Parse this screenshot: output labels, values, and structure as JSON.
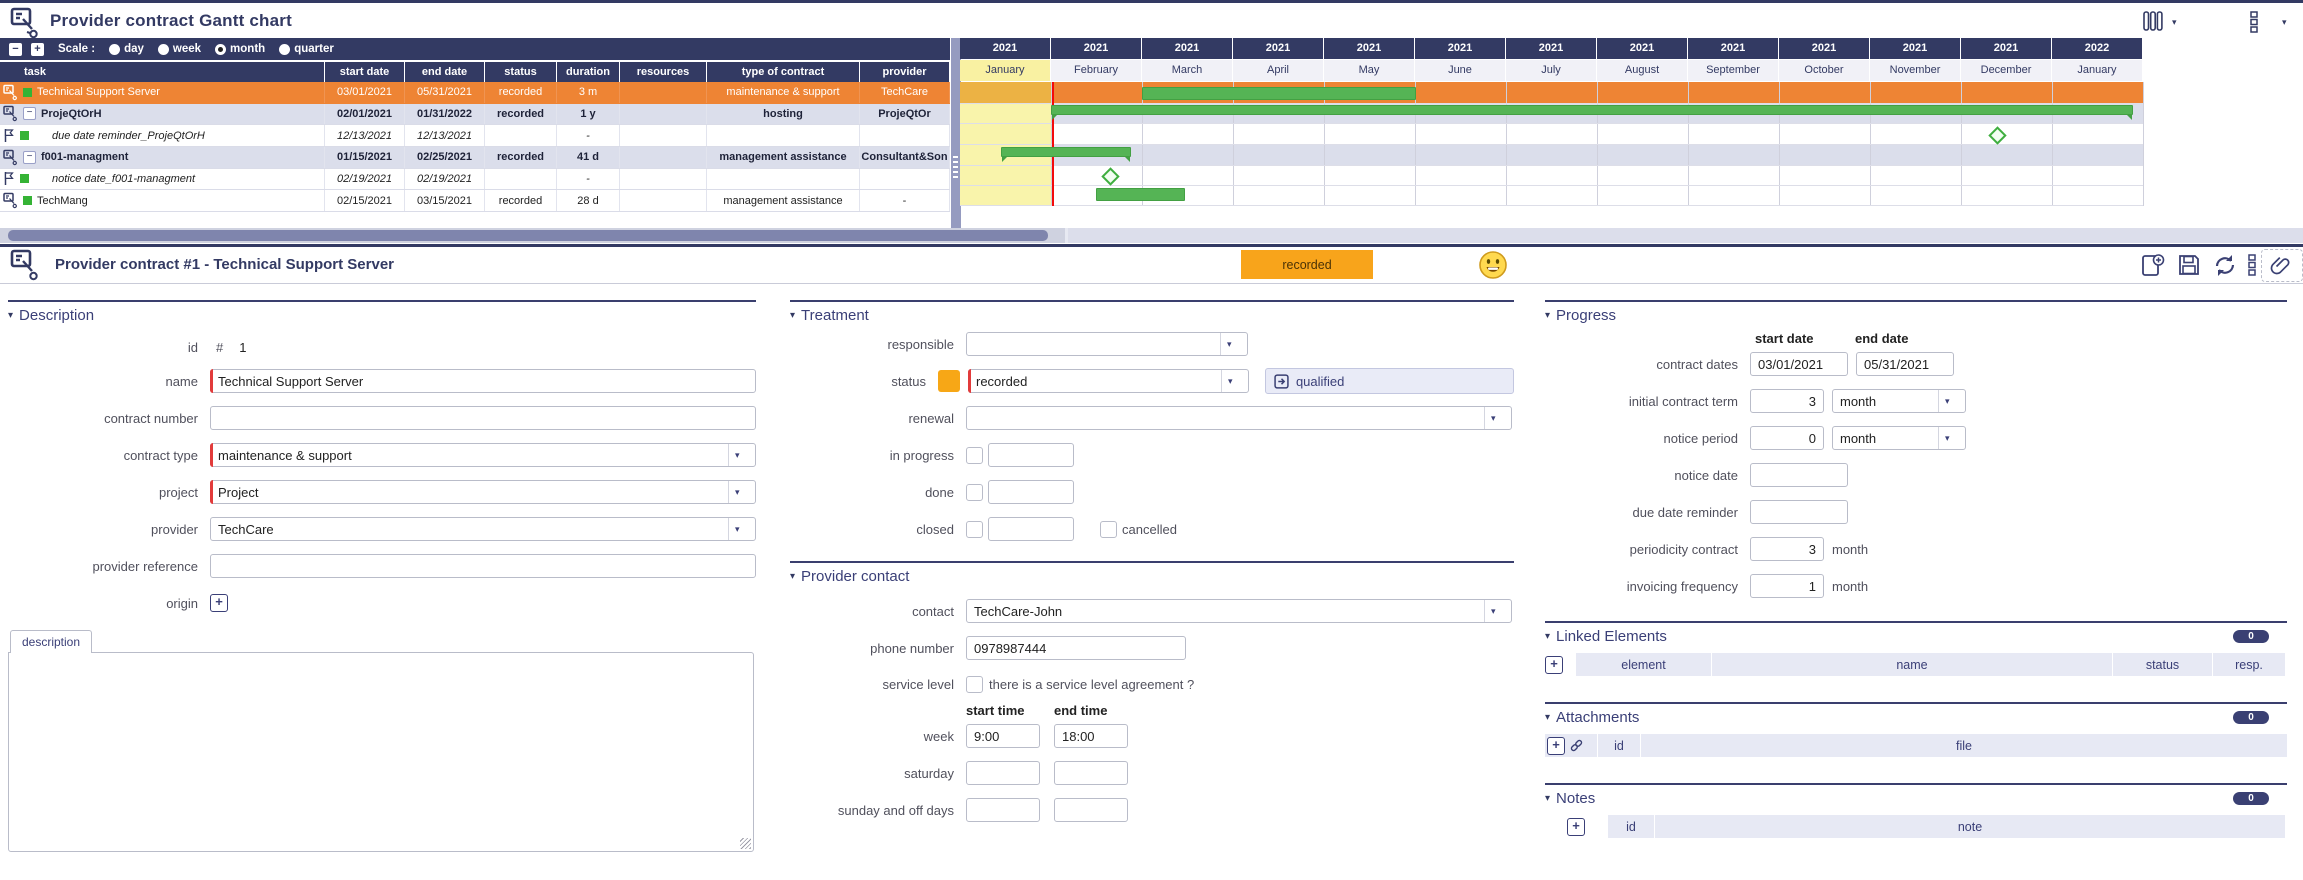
{
  "icons": {
    "caret_down": "▾",
    "plus": "+",
    "minus": "−",
    "hash": "#"
  },
  "theme": {
    "navy": "#333a63",
    "selected_orange": "#ee8434",
    "status_orange": "#f8a41b",
    "bar_green": "#55b455",
    "today_red": "#f30b0b",
    "current_month_yellow": "#f9f4ab",
    "required_red": "#e23b3b"
  },
  "gantt": {
    "title": "Provider contract Gantt chart",
    "scale_label": "Scale :",
    "scale_options": [
      {
        "label": "day",
        "selected": false
      },
      {
        "label": "week",
        "selected": false
      },
      {
        "label": "month",
        "selected": true
      },
      {
        "label": "quarter",
        "selected": false
      }
    ],
    "columns": [
      "task",
      "start date",
      "end date",
      "status",
      "duration",
      "resources",
      "type of contract",
      "provider"
    ],
    "rows": [
      {
        "task": "Technical Support Server",
        "start_date": "03/01/2021",
        "end_date": "05/31/2021",
        "status": "recorded",
        "duration": "3 m",
        "resources": "",
        "type_of_contract": "maintenance & support",
        "provider": "TechCare"
      },
      {
        "task": "ProjeQtOrH",
        "start_date": "02/01/2021",
        "end_date": "01/31/2022",
        "status": "recorded",
        "duration": "1 y",
        "resources": "",
        "type_of_contract": "hosting",
        "provider": "ProjeQtOr",
        "collapse": "−"
      },
      {
        "task": "due date reminder_ProjeQtOrH",
        "start_date": "12/13/2021",
        "end_date": "12/13/2021",
        "status": "",
        "duration": "-",
        "resources": "",
        "type_of_contract": "",
        "provider": ""
      },
      {
        "task": "f001-managment",
        "start_date": "01/15/2021",
        "end_date": "02/25/2021",
        "status": "recorded",
        "duration": "41 d",
        "resources": "",
        "type_of_contract": "management assistance",
        "provider": "Consultant&Son",
        "collapse": "−"
      },
      {
        "task": "notice date_f001-managment",
        "start_date": "02/19/2021",
        "end_date": "02/19/2021",
        "status": "",
        "duration": "-",
        "resources": "",
        "type_of_contract": "",
        "provider": ""
      },
      {
        "task": "TechMang",
        "start_date": "02/15/2021",
        "end_date": "03/15/2021",
        "status": "recorded",
        "duration": "28 d",
        "resources": "",
        "type_of_contract": "management assistance",
        "provider": "-"
      }
    ],
    "timeline": {
      "cols": [
        {
          "y": "2021",
          "m": "January"
        },
        {
          "y": "2021",
          "m": "February"
        },
        {
          "y": "2021",
          "m": "March"
        },
        {
          "y": "2021",
          "m": "April"
        },
        {
          "y": "2021",
          "m": "May"
        },
        {
          "y": "2021",
          "m": "June"
        },
        {
          "y": "2021",
          "m": "July"
        },
        {
          "y": "2021",
          "m": "August"
        },
        {
          "y": "2021",
          "m": "September"
        },
        {
          "y": "2021",
          "m": "October"
        },
        {
          "y": "2021",
          "m": "November"
        },
        {
          "y": "2021",
          "m": "December"
        },
        {
          "y": "2022",
          "m": "January"
        }
      ]
    }
  },
  "detail": {
    "header": {
      "title": "Provider contract  #1  - Technical Support Server",
      "status_badge": "recorded"
    },
    "description": {
      "title": "Description",
      "id_label": "id",
      "id_value": "1",
      "name_label": "name",
      "name_value": "Technical Support Server",
      "contract_number_label": "contract number",
      "contract_number_value": "",
      "contract_type_label": "contract type",
      "contract_type_value": "maintenance & support",
      "project_label": "project",
      "project_value": "Project",
      "provider_label": "provider",
      "provider_value": "TechCare",
      "provider_reference_label": "provider reference",
      "provider_reference_value": "",
      "origin_label": "origin",
      "tab_label": "description",
      "textarea_value": ""
    },
    "treatment": {
      "title": "Treatment",
      "responsible_label": "responsible",
      "responsible_value": "",
      "status_label": "status",
      "status_value": "recorded",
      "qualified_label": "qualified",
      "renewal_label": "renewal",
      "renewal_value": "",
      "in_progress_label": "in progress",
      "in_progress_value": "",
      "done_label": "done",
      "done_value": "",
      "closed_label": "closed",
      "closed_value": "",
      "cancelled_label": "cancelled"
    },
    "provider_contact": {
      "title": "Provider contact",
      "contact_label": "contact",
      "contact_value": "TechCare-John",
      "phone_label": "phone number",
      "phone_value": "0978987444",
      "service_level_label": "service level",
      "sla_text": "there is a service level agreement ?",
      "start_time_header": "start time",
      "end_time_header": "end time",
      "week_label": "week",
      "week_start": "9:00",
      "week_end": "18:00",
      "saturday_label": "saturday",
      "saturday_start": "",
      "saturday_end": "",
      "sunday_label": "sunday and off days",
      "sunday_start": "",
      "sunday_end": ""
    },
    "progress": {
      "title": "Progress",
      "start_date_header": "start date",
      "end_date_header": "end date",
      "contract_dates_label": "contract dates",
      "contract_start": "03/01/2021",
      "contract_end": "05/31/2021",
      "initial_term_label": "initial contract term",
      "initial_term_value": "3",
      "initial_term_unit": "month",
      "notice_period_label": "notice period",
      "notice_period_value": "0",
      "notice_period_unit": "month",
      "notice_date_label": "notice date",
      "notice_date_value": "",
      "due_date_reminder_label": "due date reminder",
      "due_date_reminder_value": "",
      "periodicity_label": "periodicity contract",
      "periodicity_value": "3",
      "periodicity_unit": "month",
      "invoicing_label": "invoicing frequency",
      "invoicing_value": "1",
      "invoicing_unit": "month"
    },
    "linked_elements": {
      "title": "Linked Elements",
      "count": "0",
      "headers": [
        "element",
        "name",
        "status",
        "resp."
      ]
    },
    "attachments": {
      "title": "Attachments",
      "count": "0",
      "headers": [
        "id",
        "file"
      ]
    },
    "notes": {
      "title": "Notes",
      "count": "0",
      "headers": [
        "id",
        "note"
      ]
    }
  }
}
